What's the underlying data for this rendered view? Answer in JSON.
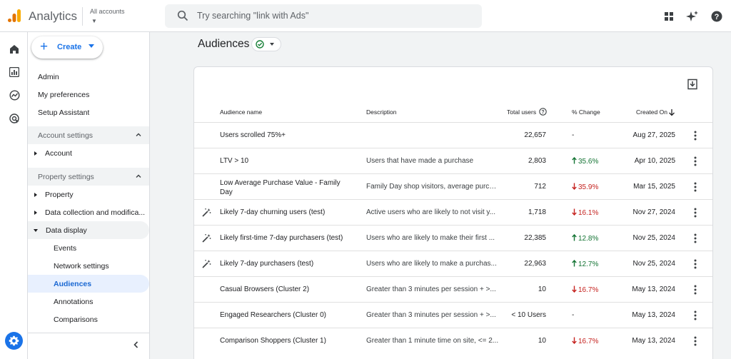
{
  "header": {
    "app_title": "Analytics",
    "account_label": "All accounts",
    "search_placeholder": "Try searching \"link with Ads\""
  },
  "nav": {
    "create_label": "Create",
    "top_items": [
      "Admin",
      "My preferences",
      "Setup Assistant"
    ],
    "account_section": "Account settings",
    "account_item": "Account",
    "property_section": "Property settings",
    "property_items": [
      "Property",
      "Data collection and modifica...",
      "Data display"
    ],
    "data_display_items": [
      "Events",
      "Network settings",
      "Audiences",
      "Annotations",
      "Comparisons"
    ]
  },
  "page": {
    "title": "Audiences"
  },
  "table": {
    "columns": {
      "name": "Audience name",
      "description": "Description",
      "total_users": "Total users",
      "change": "% Change",
      "created_on": "Created On"
    },
    "rows": [
      {
        "name": "Users scrolled 75%+",
        "name2": "",
        "description": "",
        "users": "22,657",
        "change": "-",
        "dir": "none",
        "created": "Aug 27, 2025",
        "predictive": false
      },
      {
        "name": "LTV > 10",
        "name2": "",
        "description": "Users that have made a purchase",
        "users": "2,803",
        "change": "35.6%",
        "dir": "up",
        "created": "Apr 10, 2025",
        "predictive": false
      },
      {
        "name": "Low Average Purchase Value - Family",
        "name2": "Day",
        "description": "Family Day shop visitors, average purch...",
        "users": "712",
        "change": "35.9%",
        "dir": "down",
        "created": "Mar 15, 2025",
        "predictive": false
      },
      {
        "name": "Likely 7-day churning users (test)",
        "name2": "",
        "description": "Active users who are likely to not visit y...",
        "users": "1,718",
        "change": "16.1%",
        "dir": "down",
        "created": "Nov 27, 2024",
        "predictive": true
      },
      {
        "name": "Likely first-time 7-day purchasers (test)",
        "name2": "",
        "description": "Users who are likely to make their first ...",
        "users": "22,385",
        "change": "12.8%",
        "dir": "up",
        "created": "Nov 25, 2024",
        "predictive": true
      },
      {
        "name": "Likely 7-day purchasers (test)",
        "name2": "",
        "description": "Users who are likely to make a purchas...",
        "users": "22,963",
        "change": "12.7%",
        "dir": "up",
        "created": "Nov 25, 2024",
        "predictive": true
      },
      {
        "name": "Casual Browsers (Cluster 2)",
        "name2": "",
        "description": "Greater than 3 minutes per session + >...",
        "users": "10",
        "change": "16.7%",
        "dir": "down",
        "created": "May 13, 2024",
        "predictive": false
      },
      {
        "name": "Engaged Researchers (Cluster 0)",
        "name2": "",
        "description": "Greater than 3 minutes per session + >...",
        "users": "< 10 Users",
        "change": "-",
        "dir": "none",
        "created": "May 13, 2024",
        "predictive": false
      },
      {
        "name": "Comparison Shoppers (Cluster 1)",
        "name2": "",
        "description": "Greater than 1 minute time on site, <= 2...",
        "users": "10",
        "change": "16.7%",
        "dir": "down",
        "created": "May 13, 2024",
        "predictive": false
      }
    ]
  },
  "colors": {
    "accent": "#1a73e8",
    "positive": "#137333",
    "negative": "#c5221f",
    "logo_orange": "#f9ab00",
    "logo_dark_orange": "#e37400"
  }
}
